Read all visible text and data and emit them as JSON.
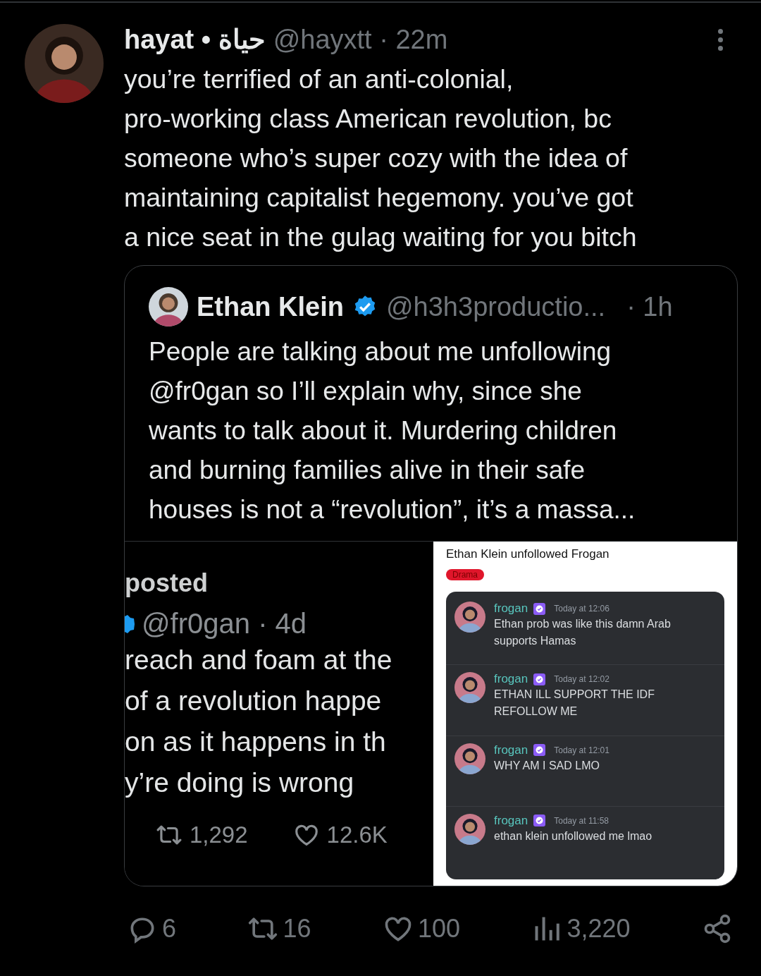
{
  "post": {
    "display_name": "hayat • حياة",
    "meta": "@hayxtt · 22m",
    "text": "you’re terrified of an anti-colonial,\npro-working class American revolution, bc\nsomeone who’s super cozy with the idea of\nmaintaining capitalist hegemony. you’ve got\na nice seat in the gulag waiting for you bitch"
  },
  "quote": {
    "display_name": "Ethan Klein",
    "verified": true,
    "handle": "@h3h3productio...",
    "time": "· 1h",
    "text": "People are talking about me unfollowing\n@fr0gan so I’ll explain why, since she\nwants to talk about it. Murdering children\nand burning families alive in their safe\nhouses is not a “revolution”, it’s a massa...",
    "media": {
      "left": {
        "label": "posted",
        "handle": "@fr0gan · 4d",
        "lines": [
          "reach and foam at the",
          "of a revolution happe",
          "on as it happens in th",
          "y’re doing is wrong"
        ],
        "stats": [
          {
            "kind": "retweet",
            "count": "1,292"
          },
          {
            "kind": "like",
            "count": "12.6K"
          }
        ]
      },
      "right": {
        "title": "Ethan Klein unfollowed Frogan",
        "tag": "Drama",
        "messages": [
          {
            "author": "frogan",
            "time": "Today at 12:06",
            "text": "Ethan prob was like this damn Arab supports Hamas"
          },
          {
            "author": "frogan",
            "time": "Today at 12:02",
            "text": "ETHAN ILL SUPPORT THE IDF REFOLLOW ME"
          },
          {
            "author": "frogan",
            "time": "Today at 12:01",
            "text": "WHY AM I SAD LMO"
          },
          {
            "author": "frogan",
            "time": "Today at 11:58",
            "text": "ethan klein unfollowed me lmao"
          }
        ]
      }
    }
  },
  "actions": [
    {
      "kind": "reply",
      "count": "6"
    },
    {
      "kind": "retweet",
      "count": "16"
    },
    {
      "kind": "like",
      "count": "100"
    },
    {
      "kind": "views",
      "count": "3,220"
    },
    {
      "kind": "share"
    }
  ]
}
